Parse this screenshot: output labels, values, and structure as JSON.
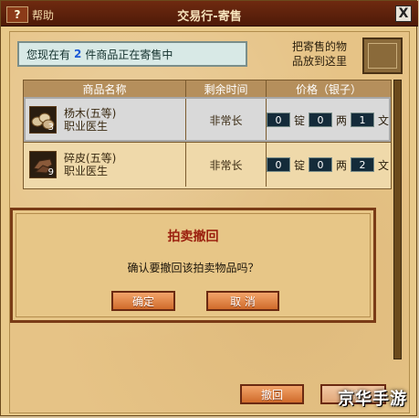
{
  "window": {
    "help_label": "帮助",
    "help_badge": "?",
    "title": "交易行-寄售",
    "close_glyph": "X"
  },
  "status_bar": {
    "prefix": "您现在有",
    "count": "2",
    "suffix": "件商品正在寄售中"
  },
  "drop_area": {
    "line1": "把寄售的物",
    "line2": "品放到这里"
  },
  "table": {
    "headers": [
      "商品名称",
      "剩余时间",
      "价格（银子）"
    ],
    "rows": [
      {
        "icon": "wood-logs-icon",
        "qty": "3",
        "name": "杨木(五等)",
        "sub": "职业医生",
        "time": "非常长",
        "price": {
          "ding": "0",
          "liang": "0",
          "wen": "1"
        },
        "selected": true
      },
      {
        "icon": "leather-scraps-icon",
        "qty": "9",
        "name": "碎皮(五等)",
        "sub": "职业医生",
        "time": "非常长",
        "price": {
          "ding": "0",
          "liang": "0",
          "wen": "2"
        },
        "selected": false
      }
    ],
    "units": {
      "ding": "锭",
      "liang": "两",
      "wen": "文"
    }
  },
  "dialog": {
    "title": "拍卖撤回",
    "message": "确认要撤回该拍卖物品吗？",
    "confirm": "确定",
    "cancel": "取 消"
  },
  "footer": {
    "withdraw": "撤回",
    "refresh": "刷新"
  },
  "watermark": "京华手游",
  "colors": {
    "accent": "#d06b2b",
    "title_bar": "#5b2210",
    "dialog_title": "#9a1f0e"
  }
}
